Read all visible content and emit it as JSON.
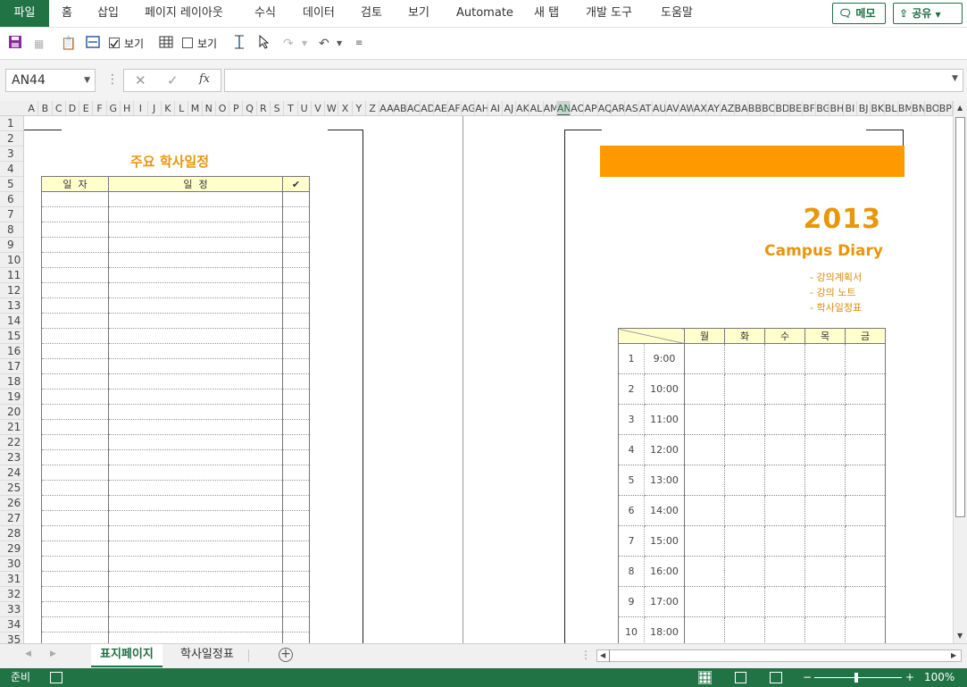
{
  "ribbon": {
    "tabs": [
      "파일",
      "홈",
      "삽입",
      "페이지 레이아웃",
      "수식",
      "데이터",
      "검토",
      "보기",
      "Automate",
      "새 탭",
      "개발 도구",
      "도움말"
    ],
    "memo_label": "메모",
    "share_label": "공유"
  },
  "quick_access": {
    "view_label_1": "보기",
    "view_label_2": "보기",
    "checkbox_1_checked": true,
    "checkbox_2_checked": false
  },
  "formula_bar": {
    "name_box": "AN44",
    "fx_label": "fx",
    "formula_value": ""
  },
  "grid": {
    "columns": [
      "A",
      "B",
      "C",
      "D",
      "E",
      "F",
      "G",
      "H",
      "I",
      "J",
      "K",
      "L",
      "M",
      "N",
      "O",
      "P",
      "Q",
      "R",
      "S",
      "T",
      "U",
      "V",
      "W",
      "X",
      "Y",
      "Z",
      "AA",
      "AB",
      "AC",
      "AD",
      "AE",
      "AF",
      "AG",
      "AH",
      "AI",
      "AJ",
      "AK",
      "AL",
      "AM",
      "AN",
      "AO",
      "AP",
      "AQ",
      "AR",
      "AS",
      "AT",
      "AU",
      "AV",
      "AW",
      "AX",
      "AY",
      "AZ",
      "BA",
      "BB",
      "BC",
      "BD",
      "BE",
      "BF",
      "BG",
      "BH",
      "BI",
      "BJ",
      "BK",
      "BL",
      "BM",
      "BN",
      "BO",
      "BP"
    ],
    "selected_column": "AN",
    "rows": [
      "1",
      "2",
      "3",
      "4",
      "5",
      "6",
      "7",
      "8",
      "9",
      "10",
      "11",
      "12",
      "13",
      "14",
      "15",
      "16",
      "17",
      "18",
      "19",
      "20",
      "21",
      "22",
      "23",
      "24",
      "25",
      "26",
      "27",
      "28",
      "29",
      "30",
      "31",
      "32",
      "33",
      "34",
      "35"
    ]
  },
  "left_page": {
    "title": "주요 학사일정",
    "headers": [
      "일  자",
      "일  정",
      "✔"
    ]
  },
  "right_page": {
    "year": "2013",
    "subtitle": "Campus Diary",
    "bullets": [
      "- 강의계획서",
      "- 강의 노트",
      "- 학사일정표"
    ],
    "timetable_days": [
      "월",
      "화",
      "수",
      "목",
      "금"
    ],
    "timetable_rows": [
      {
        "period": "1",
        "time": "9:00"
      },
      {
        "period": "2",
        "time": "10:00"
      },
      {
        "period": "3",
        "time": "11:00"
      },
      {
        "period": "4",
        "time": "12:00"
      },
      {
        "period": "5",
        "time": "13:00"
      },
      {
        "period": "6",
        "time": "14:00"
      },
      {
        "period": "7",
        "time": "15:00"
      },
      {
        "period": "8",
        "time": "16:00"
      },
      {
        "period": "9",
        "time": "17:00"
      },
      {
        "period": "10",
        "time": "18:00"
      }
    ],
    "accent_color": "#ff9900"
  },
  "sheet_tabs": [
    "표지페이지",
    "학사일정표"
  ],
  "active_sheet": "표지페이지",
  "status": {
    "ready": "준비",
    "zoom": "100%"
  },
  "theme": {
    "excel_green": "#217346",
    "title_orange": "#e8960a",
    "header_fill": "#ffffcc"
  }
}
